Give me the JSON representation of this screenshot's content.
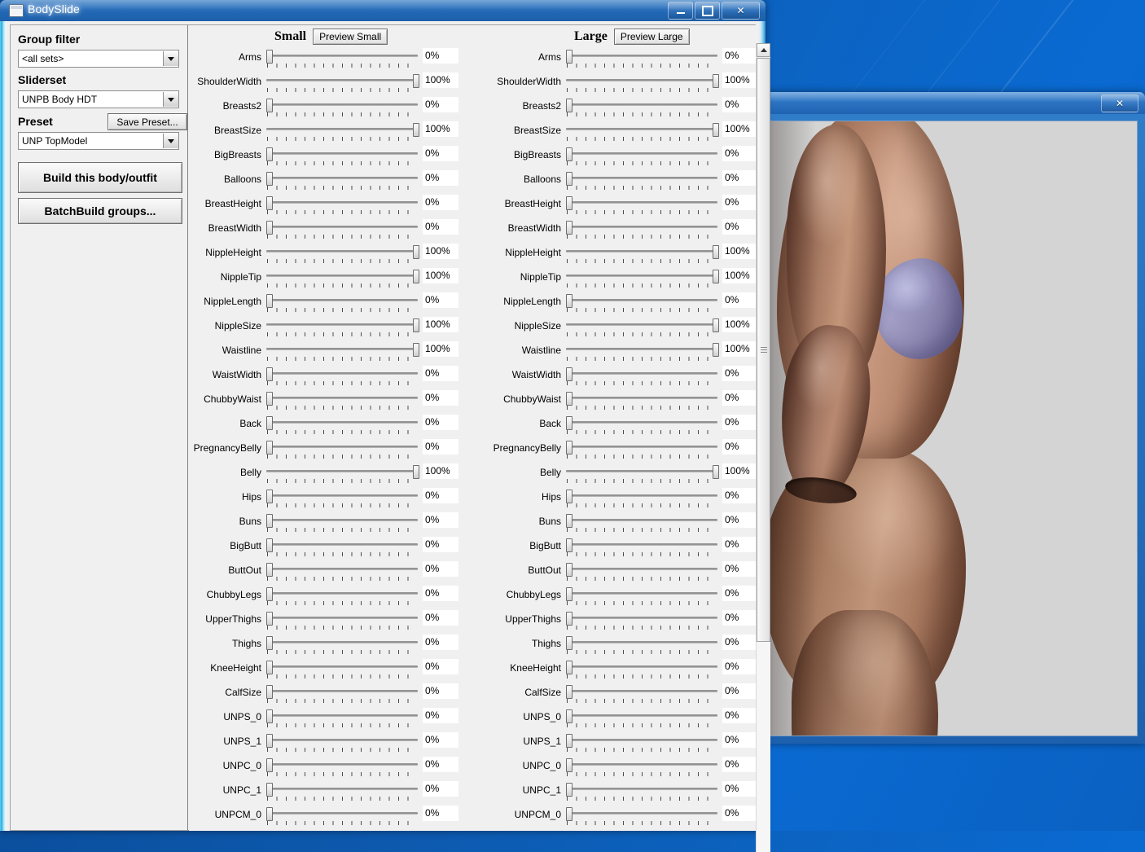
{
  "desktop": {
    "background_color": "#0b5cb5"
  },
  "main_window": {
    "title": "BodySlide",
    "app_icon": "window-icon",
    "controls": {
      "minimize": "–",
      "maximize": "□",
      "close": "✕"
    }
  },
  "left_panel": {
    "group_filter_label": "Group filter",
    "group_filter_value": "<all sets>",
    "sliderset_label": "Sliderset",
    "sliderset_value": "UNPB Body HDT",
    "preset_label": "Preset",
    "preset_value": "UNP TopModel",
    "save_preset_button": "Save Preset...",
    "build_button": "Build this body/outfit",
    "batchbuild_button": "BatchBuild groups..."
  },
  "slider_panel": {
    "small_column": {
      "title": "Small",
      "preview_button": "Preview Small"
    },
    "large_column": {
      "title": "Large",
      "preview_button": "Preview Large"
    },
    "sliders": [
      {
        "label": "Arms",
        "small": "0%",
        "large": "0%"
      },
      {
        "label": "ShoulderWidth",
        "small": "100%",
        "large": "100%"
      },
      {
        "label": "Breasts2",
        "small": "0%",
        "large": "0%"
      },
      {
        "label": "BreastSize",
        "small": "100%",
        "large": "100%"
      },
      {
        "label": "BigBreasts",
        "small": "0%",
        "large": "0%"
      },
      {
        "label": "Balloons",
        "small": "0%",
        "large": "0%"
      },
      {
        "label": "BreastHeight",
        "small": "0%",
        "large": "0%"
      },
      {
        "label": "BreastWidth",
        "small": "0%",
        "large": "0%"
      },
      {
        "label": "NippleHeight",
        "small": "100%",
        "large": "100%"
      },
      {
        "label": "NippleTip",
        "small": "100%",
        "large": "100%"
      },
      {
        "label": "NippleLength",
        "small": "0%",
        "large": "0%"
      },
      {
        "label": "NippleSize",
        "small": "100%",
        "large": "100%"
      },
      {
        "label": "Waistline",
        "small": "100%",
        "large": "100%"
      },
      {
        "label": "WaistWidth",
        "small": "0%",
        "large": "0%"
      },
      {
        "label": "ChubbyWaist",
        "small": "0%",
        "large": "0%"
      },
      {
        "label": "Back",
        "small": "0%",
        "large": "0%"
      },
      {
        "label": "PregnancyBelly",
        "small": "0%",
        "large": "0%"
      },
      {
        "label": "Belly",
        "small": "100%",
        "large": "100%"
      },
      {
        "label": "Hips",
        "small": "0%",
        "large": "0%"
      },
      {
        "label": "Buns",
        "small": "0%",
        "large": "0%"
      },
      {
        "label": "BigButt",
        "small": "0%",
        "large": "0%"
      },
      {
        "label": "ButtOut",
        "small": "0%",
        "large": "0%"
      },
      {
        "label": "ChubbyLegs",
        "small": "0%",
        "large": "0%"
      },
      {
        "label": "UpperThighs",
        "small": "0%",
        "large": "0%"
      },
      {
        "label": "Thighs",
        "small": "0%",
        "large": "0%"
      },
      {
        "label": "KneeHeight",
        "small": "0%",
        "large": "0%"
      },
      {
        "label": "CalfSize",
        "small": "0%",
        "large": "0%"
      },
      {
        "label": "UNPS_0",
        "small": "0%",
        "large": "0%"
      },
      {
        "label": "UNPS_1",
        "small": "0%",
        "large": "0%"
      },
      {
        "label": "UNPC_0",
        "small": "0%",
        "large": "0%"
      },
      {
        "label": "UNPC_1",
        "small": "0%",
        "large": "0%"
      },
      {
        "label": "UNPCM_0",
        "small": "0%",
        "large": "0%"
      }
    ]
  },
  "scrollbar": {
    "up_arrow": "▲"
  },
  "preview_window": {
    "title": "",
    "close_button": "✕",
    "canvas_background": "#d4d4d4",
    "content": "3d-body-model-preview"
  }
}
